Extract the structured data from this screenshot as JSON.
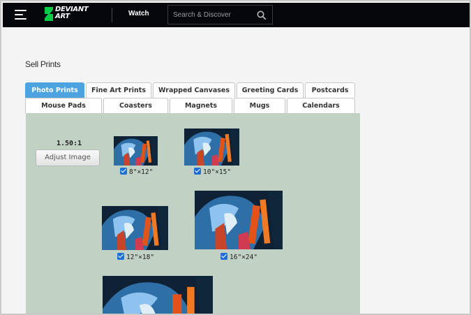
{
  "header": {
    "logo_line1": "DEVIANT",
    "logo_line2": "ART",
    "watch_label": "Watch",
    "search_placeholder": "Search & Discover"
  },
  "page": {
    "title": "Sell Prints"
  },
  "tabs_row1": [
    "Photo Prints",
    "Fine Art Prints",
    "Wrapped Canvases",
    "Greeting Cards",
    "Postcards"
  ],
  "tabs_row2": [
    "Mouse Pads",
    "Coasters",
    "Magnets",
    "Mugs",
    "Calendars"
  ],
  "active_tab": "Photo Prints",
  "editor": {
    "ratio": "1.50:1",
    "adjust_label": "Adjust Image"
  },
  "print_sizes": [
    {
      "label": "8\"×12\"",
      "checked": true
    },
    {
      "label": "10\"×15\"",
      "checked": true
    },
    {
      "label": "12\"×18\"",
      "checked": true
    },
    {
      "label": "16\"×24\"",
      "checked": true
    }
  ],
  "colors": {
    "accent": "#4da3e0",
    "topbar": "#06070d",
    "panel": "#c1d1c4",
    "checkbox": "#1f6fd6"
  }
}
